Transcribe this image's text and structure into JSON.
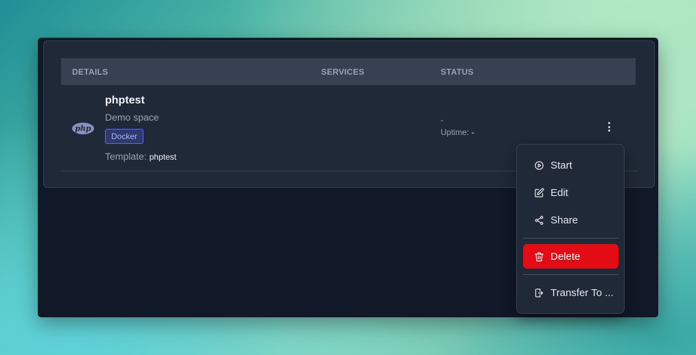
{
  "table": {
    "headers": {
      "details": "DETAILS",
      "services": "SERVICES",
      "status": "STATUS"
    },
    "rows": [
      {
        "logo_text": "php",
        "name": "phptest",
        "description": "Demo space",
        "badge": "Docker",
        "template_label": "Template:",
        "template_value": "phptest",
        "status": "-",
        "uptime_label": "Uptime:",
        "uptime_value": "-"
      }
    ]
  },
  "menu": {
    "items": [
      {
        "label": "Start",
        "icon": "play-circle-icon"
      },
      {
        "label": "Edit",
        "icon": "edit-icon"
      },
      {
        "label": "Share",
        "icon": "share-icon"
      },
      {
        "label": "Delete",
        "icon": "trash-icon"
      },
      {
        "label": "Transfer To ...",
        "icon": "transfer-icon"
      }
    ]
  },
  "colors": {
    "delete_bg": "#e30b14",
    "badge_border": "#6366f1",
    "panel_bg": "#1f2937",
    "window_bg": "#111827"
  }
}
